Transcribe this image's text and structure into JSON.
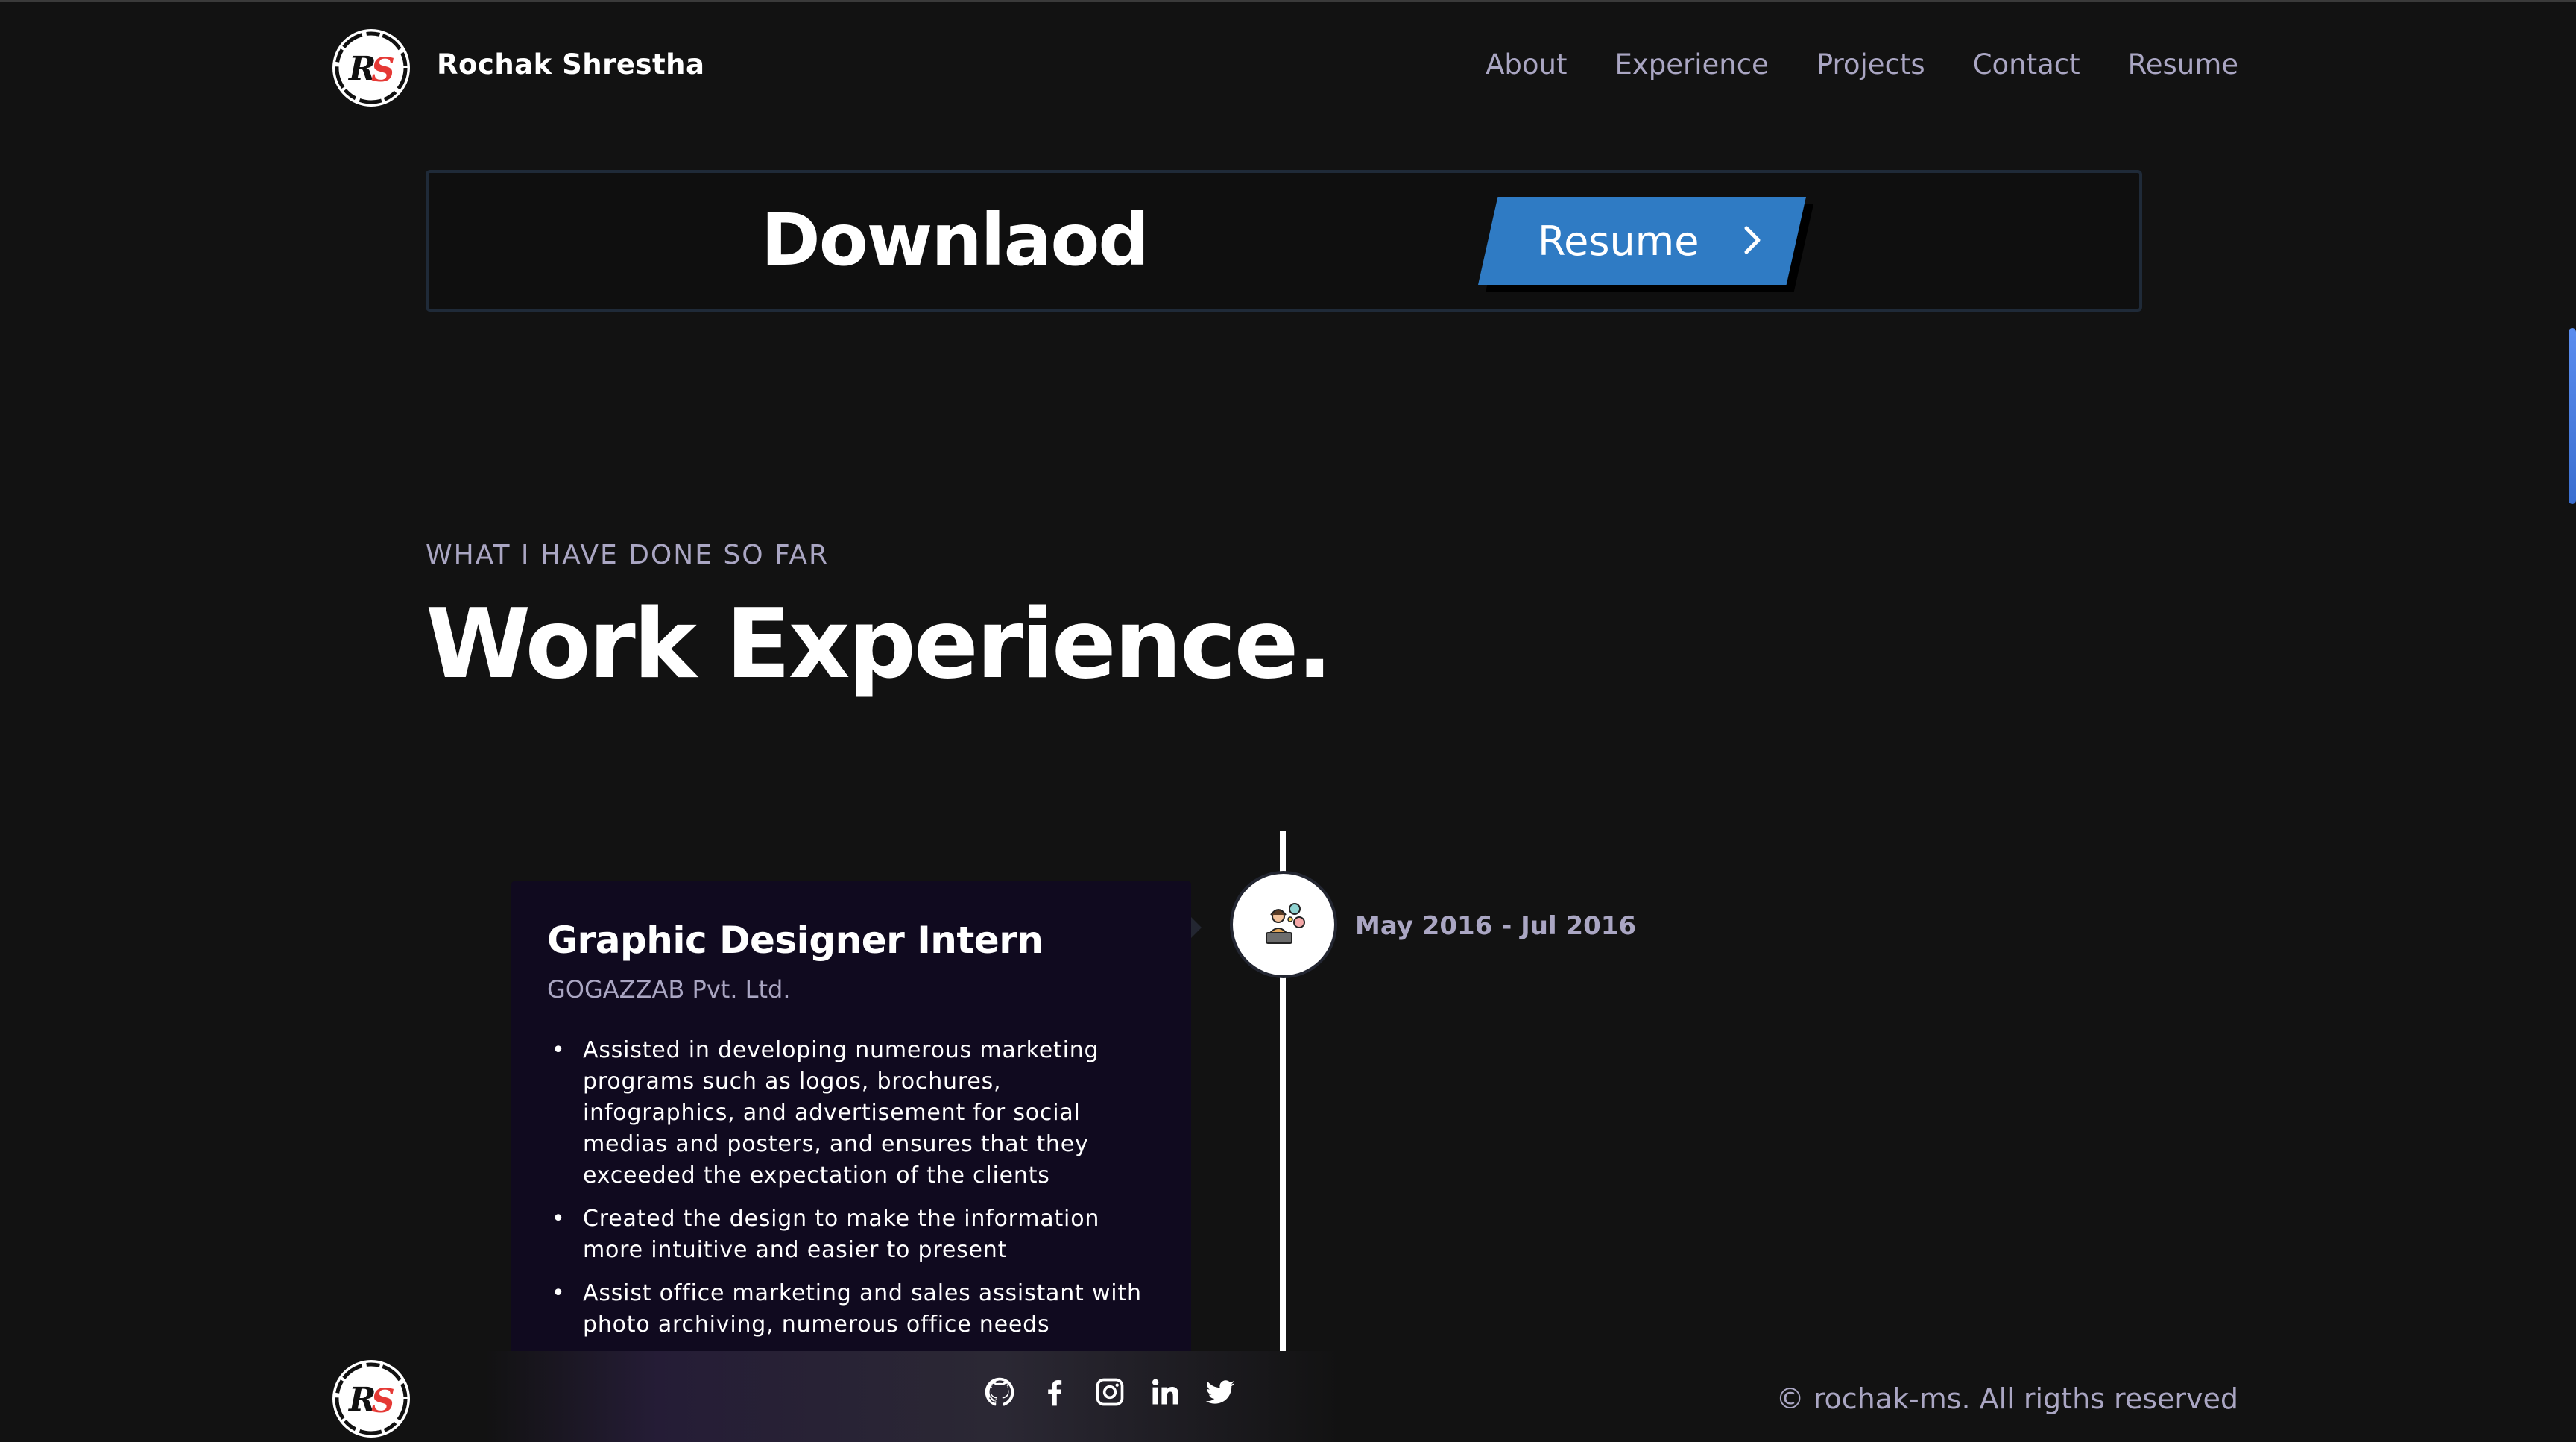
{
  "header": {
    "brand": "Rochak  Shrestha",
    "nav": [
      "About",
      "Experience",
      "Projects",
      "Contact",
      "Resume"
    ]
  },
  "download": {
    "heading": "Downlaod",
    "button_label": "Resume"
  },
  "experience": {
    "subtitle": "WHAT I HAVE DONE SO FAR",
    "title": "Work Experience.",
    "items": [
      {
        "title": "Graphic Designer Intern",
        "company": "GOGAZZAB Pvt. Ltd.",
        "date": "May 2016 - Jul 2016",
        "points": [
          "Assisted in developing numerous marketing programs such as logos, brochures, infographics, and advertisement for social medias and posters, and ensures that they exceeded the expectation of the clients",
          "Created the design to make the information more intuitive and easier to present",
          "Assist office marketing and sales assistant with photo archiving, numerous office needs"
        ]
      }
    ]
  },
  "footer": {
    "copyright": "© rochak-ms. All rigths reserved",
    "socials": [
      "github-icon",
      "facebook-icon",
      "instagram-icon",
      "linkedin-icon",
      "twitter-icon"
    ]
  },
  "colors": {
    "background": "#121212",
    "accent": "#2f7bc4",
    "card": "#100a1f",
    "secondary_text": "#aaa6c3"
  }
}
